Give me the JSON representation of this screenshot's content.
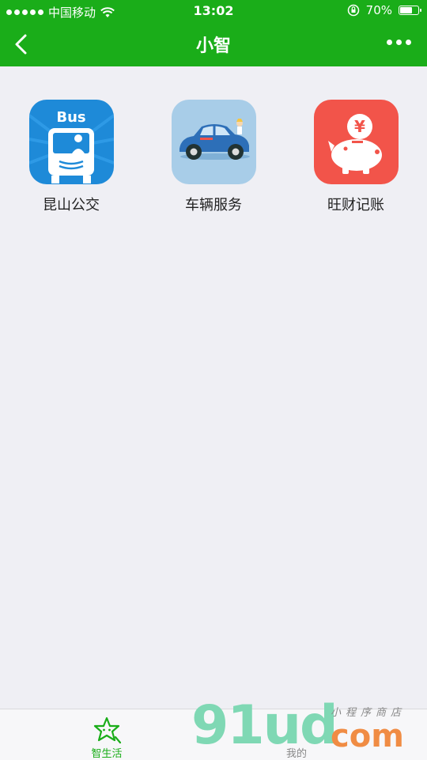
{
  "status_bar": {
    "carrier": "中国移动",
    "time": "13:02",
    "battery_text": "70%",
    "battery_level": 0.7
  },
  "nav": {
    "title": "小智",
    "back_icon": "chevron-left-icon",
    "more_icon": "more-dots-icon"
  },
  "apps": [
    {
      "label": "昆山公交",
      "icon": "bus-icon",
      "color": "#1e8ad8",
      "icon_text": "Bus"
    },
    {
      "label": "车辆服务",
      "icon": "car-icon",
      "color": "#a8cde8"
    },
    {
      "label": "旺财记账",
      "icon": "piggy-bank-icon",
      "color": "#f2544a",
      "icon_text": "¥"
    }
  ],
  "tabbar": {
    "tabs": [
      {
        "label": "智生活",
        "icon": "star-face-icon",
        "active": true
      },
      {
        "label": "我的",
        "active": false
      }
    ]
  },
  "watermark": {
    "big": "91ud",
    "com": "com",
    "small": "小程序商店"
  },
  "colors": {
    "accent": "#1aad19",
    "background": "#efeff4"
  }
}
